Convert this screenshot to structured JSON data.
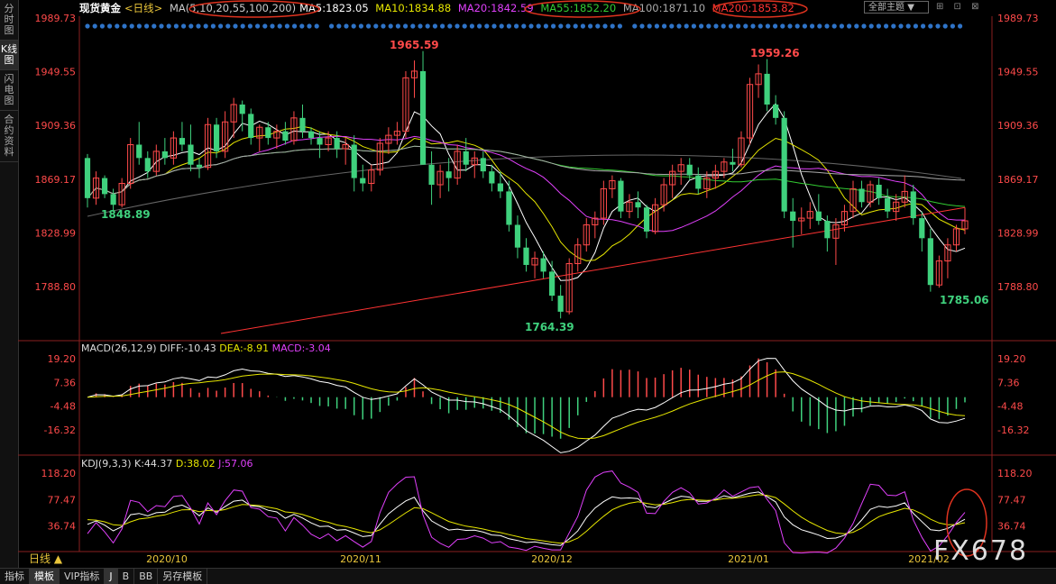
{
  "sidebar": {
    "tabs": [
      {
        "label": "分时图",
        "active": false
      },
      {
        "label": "K线图",
        "active": true
      },
      {
        "label": "闪电图",
        "active": false
      },
      {
        "label": "合约资料",
        "active": false
      }
    ]
  },
  "header": {
    "symbol": "现货黄金",
    "period": "<日线>",
    "ma_params": "MA(5,10,20,55,100,200)",
    "ma5": "MA5:1823.05",
    "ma10": "MA10:1834.88",
    "ma20": "MA20:1842.59",
    "ma55": "MA55:1852.20",
    "ma100": "MA100:1871.10",
    "ma200": "MA200:1853.82",
    "theme_label": "全部主题",
    "theme_arrow": "▼",
    "window_icons": "⊞ ⊡ ⊠"
  },
  "colors": {
    "up": "#ff4a4a",
    "down": "#3fd17d",
    "ma5": "#ffffff",
    "ma10": "#e6e600",
    "ma20": "#e040fb",
    "ma55": "#33cc33",
    "ma100": "#aaaaaa",
    "ma200": "#ff3333"
  },
  "price_axis": {
    "labels": [
      "1989.73",
      "1949.55",
      "1909.36",
      "1869.17",
      "1828.99",
      "1788.80"
    ]
  },
  "annotations": {
    "high1": "1965.59",
    "high2": "1959.26",
    "low1": "1848.89",
    "low2": "1764.39",
    "low3": "1785.06"
  },
  "macd": {
    "header": "MACD(26,12,9)",
    "diff": "DIFF:-10.43",
    "dea": "DEA:-8.91",
    "macd": "MACD:-3.04",
    "axis": [
      "19.20",
      "7.36",
      "-4.48",
      "-16.32"
    ]
  },
  "kdj": {
    "header": "KDJ(9,3,3)",
    "k": "K:44.37",
    "d": "D:38.02",
    "j": "J:57.06",
    "axis": [
      "118.20",
      "77.47",
      "36.74"
    ]
  },
  "x_axis": {
    "labels": [
      "2020/10",
      "2020/11",
      "2020/12",
      "2021/01",
      "2021/02"
    ]
  },
  "bottom": {
    "period_label": "日线 ▲",
    "tabs": [
      "指标",
      "模板",
      "VIP指标",
      "J",
      "B",
      "BB",
      "另存模板"
    ]
  },
  "watermark": "FX678",
  "chart_data": {
    "type": "candlestick",
    "ohlc": [
      [
        1885,
        1888,
        1848,
        1855
      ],
      [
        1855,
        1875,
        1850,
        1870
      ],
      [
        1870,
        1872,
        1855,
        1858
      ],
      [
        1858,
        1862,
        1845,
        1850
      ],
      [
        1850,
        1870,
        1848,
        1866
      ],
      [
        1866,
        1900,
        1862,
        1895
      ],
      [
        1895,
        1912,
        1880,
        1885
      ],
      [
        1885,
        1890,
        1870,
        1875
      ],
      [
        1875,
        1895,
        1872,
        1890
      ],
      [
        1890,
        1900,
        1880,
        1885
      ],
      [
        1885,
        1905,
        1880,
        1900
      ],
      [
        1900,
        1912,
        1890,
        1895
      ],
      [
        1895,
        1910,
        1875,
        1880
      ],
      [
        1880,
        1885,
        1870,
        1878
      ],
      [
        1878,
        1915,
        1876,
        1910
      ],
      [
        1910,
        1915,
        1885,
        1890
      ],
      [
        1890,
        1920,
        1885,
        1912
      ],
      [
        1912,
        1930,
        1900,
        1925
      ],
      [
        1925,
        1928,
        1905,
        1918
      ],
      [
        1918,
        1922,
        1895,
        1900
      ],
      [
        1900,
        1910,
        1890,
        1908
      ],
      [
        1908,
        1912,
        1895,
        1900
      ],
      [
        1900,
        1910,
        1892,
        1905
      ],
      [
        1905,
        1912,
        1895,
        1898
      ],
      [
        1898,
        1920,
        1895,
        1915
      ],
      [
        1915,
        1925,
        1900,
        1905
      ],
      [
        1905,
        1908,
        1895,
        1900
      ],
      [
        1900,
        1905,
        1885,
        1895
      ],
      [
        1895,
        1905,
        1890,
        1900
      ],
      [
        1900,
        1905,
        1885,
        1892
      ],
      [
        1892,
        1900,
        1880,
        1895
      ],
      [
        1895,
        1902,
        1860,
        1870
      ],
      [
        1870,
        1880,
        1860,
        1866
      ],
      [
        1866,
        1880,
        1860,
        1876
      ],
      [
        1876,
        1900,
        1872,
        1896
      ],
      [
        1896,
        1908,
        1888,
        1902
      ],
      [
        1902,
        1912,
        1895,
        1905
      ],
      [
        1905,
        1950,
        1900,
        1945
      ],
      [
        1945,
        1958,
        1930,
        1950
      ],
      [
        1950,
        1965,
        1880,
        1880
      ],
      [
        1880,
        1890,
        1850,
        1865
      ],
      [
        1865,
        1880,
        1855,
        1875
      ],
      [
        1875,
        1885,
        1860,
        1870
      ],
      [
        1870,
        1895,
        1865,
        1890
      ],
      [
        1890,
        1900,
        1875,
        1880
      ],
      [
        1880,
        1890,
        1870,
        1885
      ],
      [
        1885,
        1890,
        1870,
        1875
      ],
      [
        1875,
        1880,
        1860,
        1866
      ],
      [
        1866,
        1875,
        1855,
        1860
      ],
      [
        1860,
        1868,
        1830,
        1835
      ],
      [
        1835,
        1842,
        1810,
        1818
      ],
      [
        1818,
        1825,
        1800,
        1805
      ],
      [
        1805,
        1815,
        1795,
        1810
      ],
      [
        1810,
        1815,
        1795,
        1800
      ],
      [
        1800,
        1808,
        1778,
        1782
      ],
      [
        1782,
        1790,
        1765,
        1770
      ],
      [
        1770,
        1810,
        1768,
        1806
      ],
      [
        1806,
        1825,
        1800,
        1820
      ],
      [
        1820,
        1840,
        1815,
        1835
      ],
      [
        1835,
        1845,
        1825,
        1840
      ],
      [
        1840,
        1868,
        1835,
        1862
      ],
      [
        1862,
        1872,
        1855,
        1868
      ],
      [
        1868,
        1870,
        1840,
        1845
      ],
      [
        1845,
        1858,
        1840,
        1852
      ],
      [
        1852,
        1860,
        1840,
        1848
      ],
      [
        1848,
        1850,
        1825,
        1830
      ],
      [
        1830,
        1855,
        1828,
        1850
      ],
      [
        1850,
        1870,
        1845,
        1865
      ],
      [
        1865,
        1880,
        1855,
        1875
      ],
      [
        1875,
        1885,
        1865,
        1880
      ],
      [
        1880,
        1885,
        1868,
        1872
      ],
      [
        1872,
        1878,
        1858,
        1862
      ],
      [
        1862,
        1875,
        1855,
        1870
      ],
      [
        1870,
        1880,
        1862,
        1875
      ],
      [
        1875,
        1885,
        1870,
        1882
      ],
      [
        1882,
        1892,
        1875,
        1880
      ],
      [
        1880,
        1905,
        1878,
        1900
      ],
      [
        1900,
        1945,
        1895,
        1940
      ],
      [
        1940,
        1955,
        1930,
        1948
      ],
      [
        1948,
        1959,
        1920,
        1925
      ],
      [
        1925,
        1932,
        1910,
        1915
      ],
      [
        1915,
        1920,
        1840,
        1845
      ],
      [
        1845,
        1855,
        1818,
        1838
      ],
      [
        1838,
        1848,
        1828,
        1840
      ],
      [
        1840,
        1852,
        1832,
        1845
      ],
      [
        1845,
        1858,
        1835,
        1838
      ],
      [
        1838,
        1842,
        1815,
        1825
      ],
      [
        1825,
        1840,
        1805,
        1835
      ],
      [
        1835,
        1850,
        1830,
        1845
      ],
      [
        1845,
        1868,
        1840,
        1862
      ],
      [
        1862,
        1868,
        1848,
        1852
      ],
      [
        1852,
        1868,
        1848,
        1865
      ],
      [
        1865,
        1870,
        1850,
        1855
      ],
      [
        1855,
        1862,
        1840,
        1845
      ],
      [
        1845,
        1858,
        1838,
        1852
      ],
      [
        1852,
        1872,
        1848,
        1860
      ],
      [
        1860,
        1865,
        1835,
        1840
      ],
      [
        1840,
        1845,
        1815,
        1825
      ],
      [
        1825,
        1832,
        1785,
        1790
      ],
      [
        1790,
        1812,
        1788,
        1808
      ],
      [
        1808,
        1825,
        1795,
        1820
      ],
      [
        1820,
        1835,
        1815,
        1832
      ],
      [
        1832,
        1848,
        1828,
        1838
      ]
    ]
  }
}
